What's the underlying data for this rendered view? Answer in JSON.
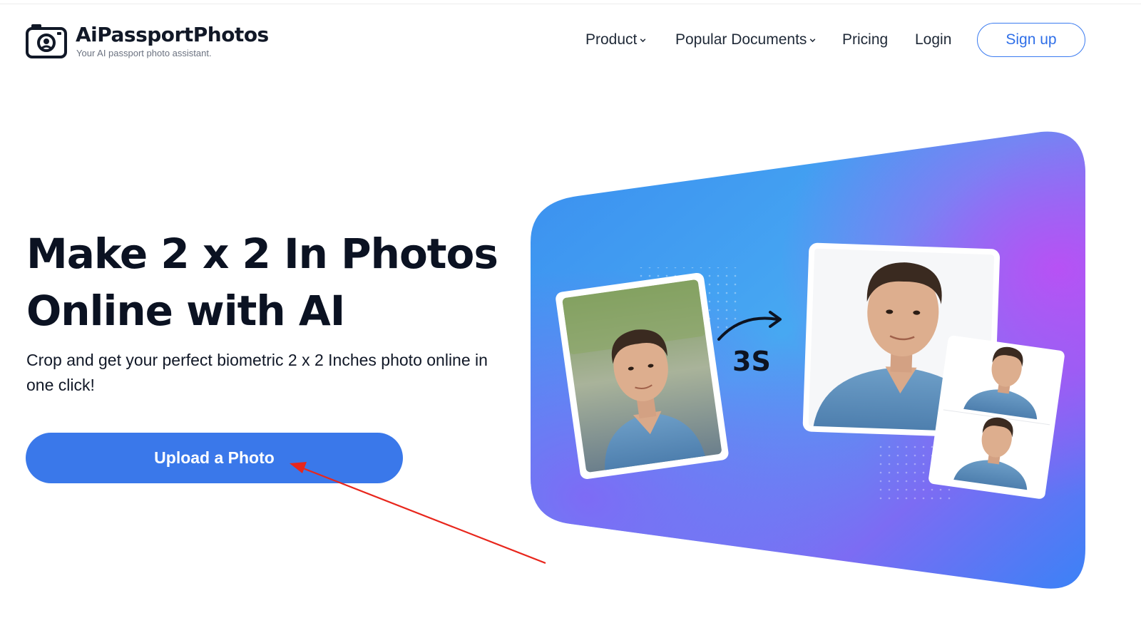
{
  "brand": {
    "name": "AiPassportPhotos",
    "tagline": "Your AI passport photo assistant."
  },
  "nav": {
    "items": [
      {
        "label": "Product",
        "has_dropdown": true
      },
      {
        "label": "Popular Documents",
        "has_dropdown": true
      },
      {
        "label": "Pricing",
        "has_dropdown": false
      },
      {
        "label": "Login",
        "has_dropdown": false
      }
    ],
    "signup_label": "Sign up"
  },
  "hero": {
    "title_line1": "Make 2 x 2 In Photos",
    "title_line2": "Online with AI",
    "subtitle": "Crop and get your perfect biometric 2 x 2 Inches photo online in one click!",
    "upload_label": "Upload a Photo"
  },
  "illustration": {
    "timing_label": "3S"
  },
  "colors": {
    "accent": "#3a78ea",
    "signup_border": "#3b7bf0",
    "gradient_blue": "#3a8ef0",
    "gradient_purple": "#9b5cf6",
    "annotation_red": "#e8261c"
  }
}
